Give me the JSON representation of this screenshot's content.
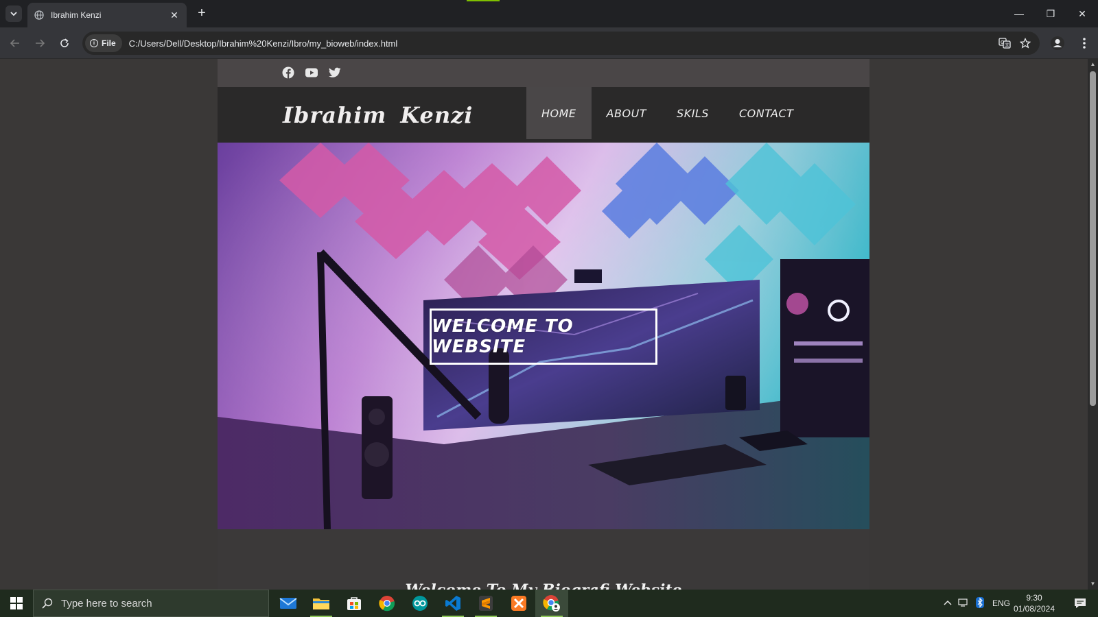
{
  "browser": {
    "tab_title": "Ibrahim Kenzi",
    "close_glyph": "✕",
    "new_tab_glyph": "+",
    "site_info_label": "File",
    "url": "C:/Users/Dell/Desktop/Ibrahim%20Kenzi/Ibro/my_bioweb/index.html",
    "window_controls": {
      "minimize": "—",
      "restore": "❐",
      "close": "✕"
    },
    "accent_color": "#7fc000"
  },
  "site": {
    "social_icons": [
      "facebook-icon",
      "youtube-icon",
      "twitter-icon"
    ],
    "logo": "Ibrahim Kenzi",
    "nav": [
      {
        "label": "HOME",
        "active": true
      },
      {
        "label": "ABOUT",
        "active": false
      },
      {
        "label": "SKILS",
        "active": false
      },
      {
        "label": "CONTACT",
        "active": false
      }
    ],
    "hero_text": "WELCOME TO WEBSITE",
    "subtitle": "Welcome To My Biografi Website"
  },
  "taskbar": {
    "search_placeholder": "Type here to search",
    "apps": [
      "mail-icon",
      "file-explorer-icon",
      "microsoft-store-icon",
      "chrome-icon",
      "arduino-icon",
      "vscode-icon",
      "sublime-text-icon",
      "xampp-icon",
      "chrome-profile-icon"
    ],
    "language": "ENG",
    "time": "9:30",
    "date": "01/08/2024"
  }
}
